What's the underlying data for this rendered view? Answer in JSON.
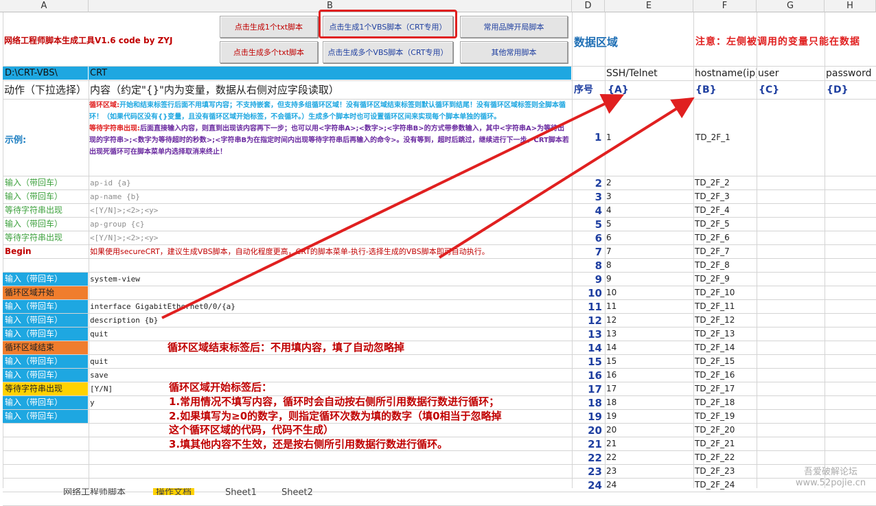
{
  "columns": [
    "A",
    "B",
    "D",
    "E",
    "F",
    "G",
    "H"
  ],
  "title": "网络工程师脚本生成工具V1.6  code by ZYJ",
  "buttons": {
    "gen1_txt": "点击生成1个txt脚本",
    "gen1_vbs": "点击生成1个VBS脚本（CRT专用）",
    "brand": "常用品牌开局脚本",
    "genmulti_txt": "点击生成多个txt脚本",
    "genmulti_vbs": "点击生成多个VBS脚本（CRT专用）",
    "other": "其他常用脚本"
  },
  "data_area": "数据区域",
  "notice": "注意：左侧被调用的变量只能在数据",
  "path": "D:\\CRT-VBS\\",
  "crt": "CRT",
  "headers": {
    "action": "动作（下拉选择）",
    "content": "内容（约定\"{}\"内为变量，数据从右侧对应字段读取）",
    "seq": "序号",
    "a": "{A}",
    "b": "{B}",
    "c": "{C}",
    "d": "{D}"
  },
  "field_names": {
    "ssh": "SSH/Telnet",
    "hostname": "hostname(ip)",
    "user": "user",
    "password": "password"
  },
  "example": {
    "label": "示例:",
    "p1_title": "循环区域:",
    "p1_text": "开始和结束标签行后面不用填写内容；不支持嵌套，但支持多组循环区域！没有循环区域结束标签则默认循环到结尾！没有循环区域标签则全脚本循环！（如果代码区没有{}变量，且没有循环区域开始标签，不会循环。）生成多个脚本时也可设置循环区间来实现每个脚本单独的循环。",
    "p2_title": "等待字符串出现:",
    "p2_text": "后面直接输入内容，则直到出现该内容再下一步；也可以用<字符串A>;<数字>;<字符串B>的方式带参数输入，其中<字符串A>为等待出现的字符串>;<数字为等待超时的秒数>;<字符串B为在指定时间内出现等待字符串后再输入的命令>。没有等到，超时后跳过，继续进行下一步。CRT脚本若出现死循环可在脚本菜单内选择取消来终止！",
    "num": "1",
    "e": "1",
    "f": "TD_2F_1"
  },
  "rows": [
    {
      "label": "输入（带回车）",
      "style": "tg",
      "cmd": "ap-id {a}",
      "g": true,
      "num": "2",
      "e": "2",
      "f": "TD_2F_2"
    },
    {
      "label": "输入（带回车）",
      "style": "tg",
      "cmd": "ap-name {b}",
      "g": true,
      "num": "3",
      "e": "3",
      "f": "TD_2F_3"
    },
    {
      "label": "等待字符串出现",
      "style": "tg",
      "cmd": "<[Y/N]>;<2>;<y>",
      "g": true,
      "num": "4",
      "e": "4",
      "f": "TD_2F_4"
    },
    {
      "label": "输入（带回车）",
      "style": "tg",
      "cmd": "ap-group {c}",
      "g": true,
      "num": "5",
      "e": "5",
      "f": "TD_2F_5"
    },
    {
      "label": "等待字符串出现",
      "style": "tg",
      "cmd": "<[Y/N]>;<2>;<y>",
      "g": true,
      "num": "6",
      "e": "6",
      "f": "TD_2F_6"
    },
    {
      "label": "Begin",
      "style": "rd",
      "cmd": "如果使用secureCRT，建议生成VBS脚本，自动化程度更高，CRT的脚本菜单-执行-选择生成的VBS脚本即可自动执行。",
      "g": false,
      "red": true,
      "num": "7",
      "e": "7",
      "f": "TD_2F_7"
    },
    {
      "label": "",
      "style": "",
      "cmd": "",
      "g": false,
      "num": "8",
      "e": "8",
      "f": "TD_2F_8"
    },
    {
      "label": "输入（带回车）",
      "style": "in",
      "cmd": "system-view",
      "g": false,
      "num": "9",
      "e": "9",
      "f": "TD_2F_9"
    },
    {
      "label": "循环区域开始",
      "style": "or",
      "cmd": "",
      "g": false,
      "num": "10",
      "e": "10",
      "f": "TD_2F_10"
    },
    {
      "label": "输入（带回车）",
      "style": "in",
      "cmd": "interface GigabitEthernet0/0/{a}",
      "g": false,
      "num": "11",
      "e": "11",
      "f": "TD_2F_11"
    },
    {
      "label": "输入（带回车）",
      "style": "in",
      "cmd": "description {b}",
      "g": false,
      "num": "12",
      "e": "12",
      "f": "TD_2F_12"
    },
    {
      "label": "输入（带回车）",
      "style": "in",
      "cmd": "quit",
      "g": false,
      "num": "13",
      "e": "13",
      "f": "TD_2F_13"
    },
    {
      "label": "循环区域结束",
      "style": "or",
      "cmd": "",
      "g": false,
      "num": "14",
      "e": "14",
      "f": "TD_2F_14"
    },
    {
      "label": "输入（带回车）",
      "style": "in",
      "cmd": "quit",
      "g": false,
      "num": "15",
      "e": "15",
      "f": "TD_2F_15"
    },
    {
      "label": "输入（带回车）",
      "style": "in",
      "cmd": "save",
      "g": false,
      "num": "16",
      "e": "16",
      "f": "TD_2F_16"
    },
    {
      "label": "等待字符串出现",
      "style": "ye",
      "cmd": "[Y/N]",
      "g": false,
      "num": "17",
      "e": "17",
      "f": "TD_2F_17"
    },
    {
      "label": "输入（带回车）",
      "style": "in",
      "cmd": "y",
      "g": false,
      "num": "18",
      "e": "18",
      "f": "TD_2F_18"
    },
    {
      "label": "输入（带回车）",
      "style": "in",
      "cmd": "",
      "g": false,
      "num": "19",
      "e": "19",
      "f": "TD_2F_19"
    },
    {
      "label": "",
      "style": "",
      "cmd": "",
      "g": false,
      "num": "20",
      "e": "20",
      "f": "TD_2F_20"
    },
    {
      "label": "",
      "style": "",
      "cmd": "",
      "g": false,
      "num": "21",
      "e": "21",
      "f": "TD_2F_21"
    },
    {
      "label": "",
      "style": "",
      "cmd": "",
      "g": false,
      "num": "22",
      "e": "22",
      "f": "TD_2F_22"
    },
    {
      "label": "",
      "style": "",
      "cmd": "",
      "g": false,
      "num": "23",
      "e": "23",
      "f": "TD_2F_23"
    },
    {
      "label": "",
      "style": "",
      "cmd": "",
      "g": false,
      "num": "24",
      "e": "24",
      "f": "TD_2F_24"
    }
  ],
  "annotations": {
    "loop_end": "循环区域结束标签后：不用填内容，填了自动忽略掉",
    "loop_start_title": "循环区域开始标签后：",
    "loop_start_1": "1.常用情况不填写内容，循环时会自动按右侧所引用数据行数进行循环；",
    "loop_start_2a": "2.如果填写为≥0的数字，则指定循环次数为填的数字（填0相当于忽略掉",
    "loop_start_2b": "这个循环区域的代码，代码不生成）",
    "loop_start_3": "3.填其他内容不生效，还是按右侧所引用数据行数进行循环。"
  },
  "sheet_tabs": [
    "网络工程师脚本",
    "操作文档",
    "Sheet1",
    "Sheet2"
  ],
  "watermark": "吾爱破解论坛 www.52pojie.cn",
  "colors": {
    "input_blue": "#1ea7e1",
    "loop_orange": "#f07d2d",
    "wait_yellow": "#ffd200",
    "annotation_red": "#c00000",
    "seq_blue": "#1f3fa0"
  }
}
